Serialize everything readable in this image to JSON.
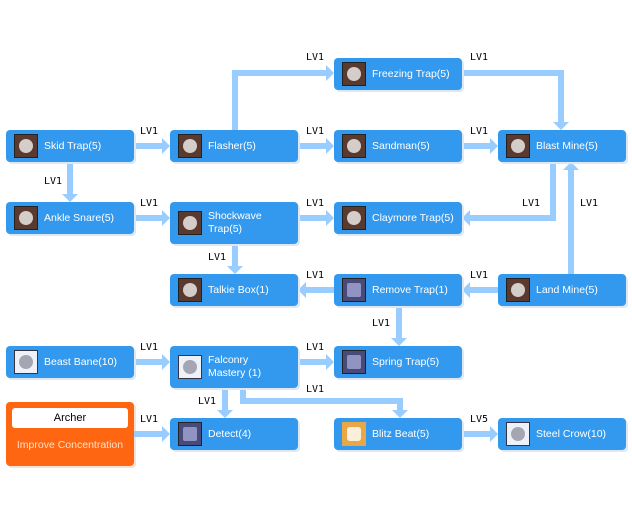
{
  "colors": {
    "skill_box": "#3399ee",
    "connector": "#99ccff",
    "base_class_box": "#ff6611",
    "skill_text": "#ffffff",
    "level_text": "#000000"
  },
  "base_class": {
    "name": "Archer",
    "prerequisite": "Improve Concentration"
  },
  "skills": [
    {
      "id": "skid-trap",
      "label": "Skid Trap(5)",
      "icon": "skid-trap-icon"
    },
    {
      "id": "flasher",
      "label": "Flasher(5)",
      "icon": "flasher-icon"
    },
    {
      "id": "freezing-trap",
      "label": "Freezing Trap(5)",
      "icon": "freezing-trap-icon"
    },
    {
      "id": "sandman",
      "label": "Sandman(5)",
      "icon": "sandman-icon"
    },
    {
      "id": "blast-mine",
      "label": "Blast Mine(5)",
      "icon": "blast-mine-icon"
    },
    {
      "id": "ankle-snare",
      "label": "Ankle Snare(5)",
      "icon": "ankle-snare-icon"
    },
    {
      "id": "shockwave-trap",
      "label": "Shockwave Trap(5)",
      "icon": "shockwave-trap-icon"
    },
    {
      "id": "claymore-trap",
      "label": "Claymore Trap(5)",
      "icon": "claymore-trap-icon"
    },
    {
      "id": "talkie-box",
      "label": "Talkie Box(1)",
      "icon": "talkie-box-icon"
    },
    {
      "id": "remove-trap",
      "label": "Remove Trap(1)",
      "icon": "remove-trap-icon"
    },
    {
      "id": "land-mine",
      "label": "Land Mine(5)",
      "icon": "land-mine-icon"
    },
    {
      "id": "beast-bane",
      "label": "Beast Bane(10)",
      "icon": "beast-bane-icon"
    },
    {
      "id": "falconry-mastery",
      "label": "Falconry Mastery (1)",
      "icon": "falconry-mastery-icon"
    },
    {
      "id": "spring-trap",
      "label": "Spring Trap(5)",
      "icon": "spring-trap-icon"
    },
    {
      "id": "detect",
      "label": "Detect(4)",
      "icon": "detect-icon"
    },
    {
      "id": "blitz-beat",
      "label": "Blitz Beat(5)",
      "icon": "blitz-beat-icon"
    },
    {
      "id": "steel-crow",
      "label": "Steel Crow(10)",
      "icon": "steel-crow-icon"
    }
  ],
  "edges": [
    {
      "from": "skid-trap",
      "to": "flasher",
      "level": "LV1"
    },
    {
      "from": "flasher",
      "to": "freezing-trap",
      "level": "LV1"
    },
    {
      "from": "flasher",
      "to": "sandman",
      "level": "LV1"
    },
    {
      "from": "freezing-trap",
      "to": "blast-mine",
      "level": "LV1"
    },
    {
      "from": "sandman",
      "to": "blast-mine",
      "level": "LV1"
    },
    {
      "from": "skid-trap",
      "to": "ankle-snare",
      "level": "LV1"
    },
    {
      "from": "ankle-snare",
      "to": "shockwave-trap",
      "level": "LV1"
    },
    {
      "from": "shockwave-trap",
      "to": "claymore-trap",
      "level": "LV1"
    },
    {
      "from": "blast-mine",
      "to": "claymore-trap",
      "level": "LV1"
    },
    {
      "from": "land-mine",
      "to": "blast-mine",
      "level": "LV1"
    },
    {
      "from": "shockwave-trap",
      "to": "talkie-box",
      "level": "LV1"
    },
    {
      "from": "remove-trap",
      "to": "talkie-box",
      "level": "LV1"
    },
    {
      "from": "land-mine",
      "to": "remove-trap",
      "level": "LV1"
    },
    {
      "from": "remove-trap",
      "to": "spring-trap",
      "level": "LV1"
    },
    {
      "from": "beast-bane",
      "to": "falconry-mastery",
      "level": "LV1"
    },
    {
      "from": "falconry-mastery",
      "to": "spring-trap",
      "level": "LV1"
    },
    {
      "from": "falconry-mastery",
      "to": "blitz-beat",
      "level": "LV1"
    },
    {
      "from": "falconry-mastery",
      "to": "detect",
      "level": "LV1"
    },
    {
      "from": "archer",
      "to": "detect",
      "level": "LV1"
    },
    {
      "from": "blitz-beat",
      "to": "steel-crow",
      "level": "LV5"
    }
  ]
}
